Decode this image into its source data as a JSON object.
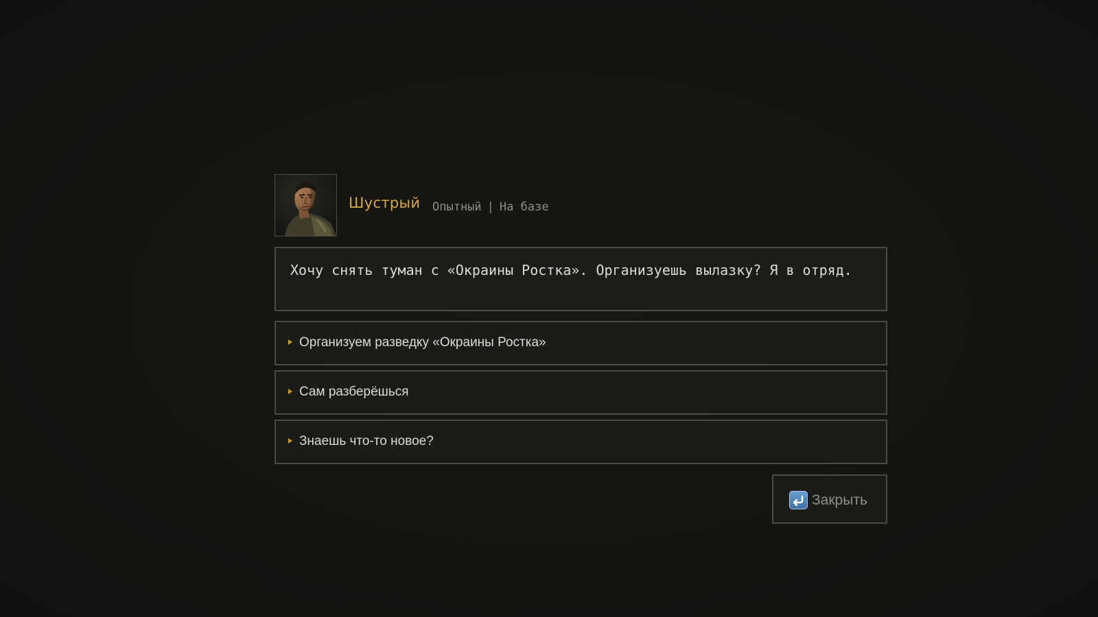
{
  "npc": {
    "name": "Шустрый",
    "rank": "Опытный",
    "separator": "|",
    "location": "На базе",
    "portrait_icon": "soldier-portrait"
  },
  "speech": {
    "text": "Хочу снять туман с «Окраины Ростка». Организуешь вылазку? Я в отряд."
  },
  "options": [
    {
      "label": "Организуем разведку «Окраины Ростка»",
      "bullet_icon": "triangle-bullet-icon"
    },
    {
      "label": "Сам разберёшься",
      "bullet_icon": "triangle-bullet-icon"
    },
    {
      "label": "Знаешь что-то новое?",
      "bullet_icon": "triangle-bullet-icon"
    }
  ],
  "close_button": {
    "label": "Закрыть",
    "icon": "return-key-icon"
  },
  "colors": {
    "background": "#141511",
    "name_accent": "#d6a94a",
    "bullet_accent": "#c49a3e",
    "border": "#4a4c42",
    "text": "#dcdcd2",
    "muted_text": "#8e8f84"
  }
}
